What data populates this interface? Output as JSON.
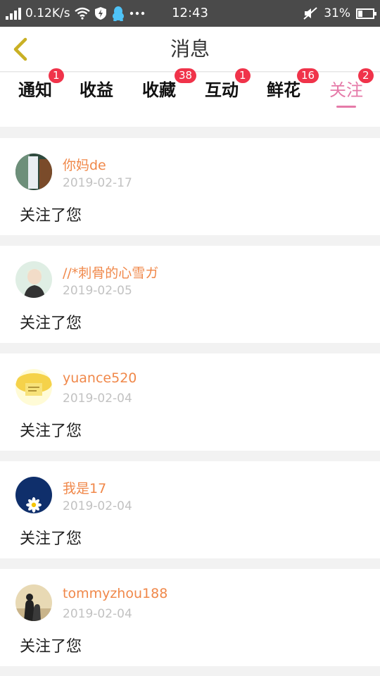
{
  "status_bar": {
    "speed": "0.12K/s",
    "time": "12:43",
    "battery_percent": "31%",
    "battery_level": 0.31,
    "icons": [
      "signal-icon",
      "wifi-icon",
      "shield-bolt-icon",
      "qq-icon",
      "more-dots-icon",
      "mute-icon",
      "battery-icon"
    ]
  },
  "header": {
    "title": "消息",
    "back_icon": "chevron-left-icon"
  },
  "tabs": [
    {
      "label": "通知",
      "badge": "1",
      "active": false
    },
    {
      "label": "收益",
      "badge": "",
      "active": false
    },
    {
      "label": "收藏",
      "badge": "38",
      "active": false
    },
    {
      "label": "互动",
      "badge": "1",
      "active": false
    },
    {
      "label": "鲜花",
      "badge": "16",
      "active": false
    },
    {
      "label": "关注",
      "badge": "2",
      "active": true
    }
  ],
  "messages": [
    {
      "username": "你妈de",
      "date": "2019-02-17",
      "text": "关注了您",
      "avatar": "avatar-photo-icon"
    },
    {
      "username": "//*刺骨的心雪ガ",
      "date": "2019-02-05",
      "text": "关注了您",
      "avatar": "avatar-photo-icon"
    },
    {
      "username": "yuance520",
      "date": "2019-02-04",
      "text": "关注了您",
      "avatar": "avatar-photo-icon"
    },
    {
      "username": "我是17",
      "date": "2019-02-04",
      "text": "关注了您",
      "avatar": "avatar-daisy-icon"
    },
    {
      "username": "tommyzhou188",
      "date": "2019-02-04",
      "text": "关注了您",
      "avatar": "avatar-photo-icon"
    }
  ],
  "colors": {
    "accent": "#e57aa8",
    "username": "#f0884a",
    "badge": "#f0334a",
    "back_arrow": "#c9b024"
  }
}
